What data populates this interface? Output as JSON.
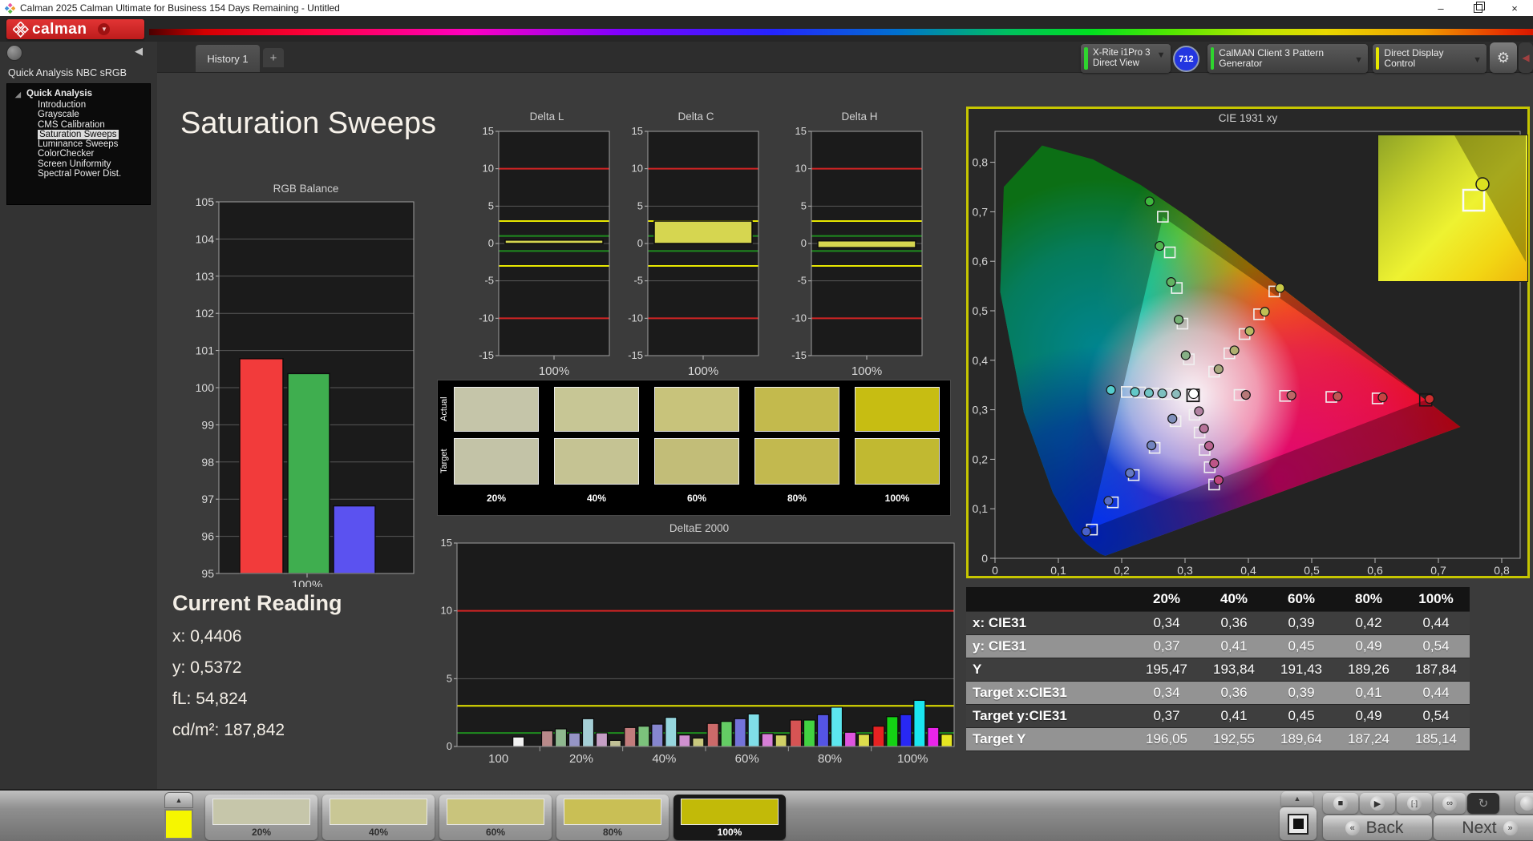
{
  "window": {
    "title": "Calman 2025 Calman Ultimate for Business 154 Days Remaining  - Untitled",
    "minimize": "–",
    "close": "×"
  },
  "logo": {
    "text": "calman"
  },
  "tabs": {
    "active": "History 1",
    "add": "+"
  },
  "toolbar": {
    "meter_line1": "X-Rite i1Pro 3",
    "meter_line2": "Direct View",
    "meter_badge": "712",
    "pattern_generator": "CalMAN Client 3 Pattern Generator",
    "display_control": "Direct Display Control"
  },
  "sidebar": {
    "header": "Quick Analysis NBC sRGB",
    "root": "Quick Analysis",
    "items": [
      {
        "label": "Introduction",
        "selected": false
      },
      {
        "label": "Grayscale",
        "selected": false
      },
      {
        "label": "CMS Calibration",
        "selected": false
      },
      {
        "label": "Saturation Sweeps",
        "selected": true
      },
      {
        "label": "Luminance Sweeps",
        "selected": false
      },
      {
        "label": "ColorChecker",
        "selected": false
      },
      {
        "label": "Screen Uniformity",
        "selected": false
      },
      {
        "label": "Spectral Power Dist.",
        "selected": false
      }
    ]
  },
  "page": {
    "title": "Saturation Sweeps"
  },
  "current_reading": {
    "title": "Current Reading",
    "values": [
      {
        "label": "x:",
        "value": "0,4406"
      },
      {
        "label": "y:",
        "value": "0,5372"
      },
      {
        "label": "fL:",
        "value": "54,824"
      },
      {
        "label": "cd/m²:",
        "value": "187,842"
      }
    ]
  },
  "swatch_panel": {
    "row_labels": [
      "Actual",
      "Target"
    ],
    "col_labels": [
      "20%",
      "40%",
      "60%",
      "80%",
      "100%"
    ],
    "actual_colors": [
      "#c5c5a9",
      "#c7c695",
      "#c8c37b",
      "#c3ba4d",
      "#c7bd12"
    ],
    "target_colors": [
      "#c3c3a7",
      "#c5c393",
      "#c2bd78",
      "#c2b94f",
      "#c1b931"
    ]
  },
  "table": {
    "headers": [
      "",
      "20%",
      "40%",
      "60%",
      "80%",
      "100%"
    ],
    "rows": [
      {
        "label": "x: CIE31",
        "values": [
          "0,34",
          "0,36",
          "0,39",
          "0,42",
          "0,44"
        ]
      },
      {
        "label": "y: CIE31",
        "values": [
          "0,37",
          "0,41",
          "0,45",
          "0,49",
          "0,54"
        ]
      },
      {
        "label": "Y",
        "values": [
          "195,47",
          "193,84",
          "191,43",
          "189,26",
          "187,84"
        ]
      },
      {
        "label": "Target x:CIE31",
        "values": [
          "0,34",
          "0,36",
          "0,39",
          "0,41",
          "0,44"
        ]
      },
      {
        "label": "Target y:CIE31",
        "values": [
          "0,37",
          "0,41",
          "0,45",
          "0,49",
          "0,54"
        ]
      },
      {
        "label": "Target Y",
        "values": [
          "196,05",
          "192,55",
          "189,64",
          "187,24",
          "185,14"
        ]
      }
    ]
  },
  "bottom_bar": {
    "stepper_color": "#f6f600",
    "levels": [
      {
        "label": "20%",
        "color": "#c6c6aa",
        "selected": false
      },
      {
        "label": "40%",
        "color": "#c9c795",
        "selected": false
      },
      {
        "label": "60%",
        "color": "#c9c47c",
        "selected": false
      },
      {
        "label": "80%",
        "color": "#c9bf55",
        "selected": false
      },
      {
        "label": "100%",
        "color": "#c2ba08",
        "selected": true
      }
    ],
    "back": "Back",
    "next": "Next"
  },
  "chart_data": [
    {
      "id": "rgb_balance",
      "type": "bar",
      "title": "RGB Balance",
      "categories": [
        "Red",
        "Green",
        "Blue"
      ],
      "values": [
        100.78,
        100.38,
        96.82
      ],
      "colors": [
        "#f23b3b",
        "#3fae4f",
        "#5b52f0"
      ],
      "xlabel": "100%",
      "ylim": [
        95,
        105
      ],
      "ytick_step": 1
    },
    {
      "id": "delta_l",
      "type": "bar",
      "title": "Delta L",
      "xlabel": "100%",
      "ylim": [
        -15,
        15
      ],
      "yticks": [
        15,
        10,
        5,
        0,
        -5,
        -10,
        -15
      ],
      "bar": {
        "from": 0,
        "to": 0.45
      },
      "bar_color": "#d6d650",
      "limits": {
        "red": 10,
        "yellow": 3,
        "green": 1
      }
    },
    {
      "id": "delta_c",
      "type": "bar",
      "title": "Delta C",
      "xlabel": "100%",
      "ylim": [
        -15,
        15
      ],
      "yticks": [
        15,
        10,
        5,
        0,
        -5,
        -10,
        -15
      ],
      "bar": {
        "from": 0,
        "to": 3.0
      },
      "bar_color": "#d6d650",
      "limits": {
        "red": 10,
        "yellow": 3,
        "green": 1
      }
    },
    {
      "id": "delta_h",
      "type": "bar",
      "title": "Delta H",
      "xlabel": "100%",
      "ylim": [
        -15,
        15
      ],
      "yticks": [
        15,
        10,
        5,
        0,
        -5,
        -10,
        -15
      ],
      "bar": {
        "from": 0.35,
        "to": -0.55
      },
      "bar_color": "#d6d650",
      "limits": {
        "red": 10,
        "yellow": 3,
        "green": 1
      }
    },
    {
      "id": "deltae_2000",
      "type": "grouped-bar",
      "title": "DeltaE 2000",
      "ylim": [
        0,
        15
      ],
      "yticks": [
        0,
        5,
        10,
        15
      ],
      "limits": {
        "red": 10,
        "yellow": 3,
        "green": 1
      },
      "groups": [
        {
          "label": "100",
          "values": [
            0.7
          ],
          "colors": [
            "#f2f2f2"
          ]
        },
        {
          "label": "20%",
          "values": [
            1.15,
            1.3,
            1.0,
            2.05,
            1.0,
            0.45
          ],
          "colors": [
            "#b88989",
            "#8fb88f",
            "#9595c5",
            "#a5cfd6",
            "#c59fc5",
            "#c0c095"
          ]
        },
        {
          "label": "40%",
          "values": [
            1.4,
            1.5,
            1.65,
            2.15,
            0.85,
            0.62
          ],
          "colors": [
            "#c27c7c",
            "#7cc27c",
            "#8686cf",
            "#96d6de",
            "#cf90cf",
            "#c8c87e"
          ]
        },
        {
          "label": "60%",
          "values": [
            1.7,
            1.85,
            2.05,
            2.4,
            0.95,
            0.85
          ],
          "colors": [
            "#cc6a6a",
            "#64cc64",
            "#7373d9",
            "#80dee8",
            "#d67ed6",
            "#d0d066"
          ]
        },
        {
          "label": "80%",
          "values": [
            1.95,
            1.95,
            2.35,
            2.9,
            1.05,
            0.9
          ],
          "colors": [
            "#d65454",
            "#42d242",
            "#5454e4",
            "#5ce6ef",
            "#de54de",
            "#dcdc4c"
          ]
        },
        {
          "label": "100%",
          "values": [
            1.5,
            2.2,
            2.35,
            3.4,
            1.4,
            0.9
          ],
          "colors": [
            "#e62222",
            "#14d214",
            "#2828f4",
            "#1ae6f0",
            "#ea24ea",
            "#e6e622"
          ]
        }
      ]
    },
    {
      "id": "cie_1931",
      "type": "scatter",
      "title": "CIE 1931 xy",
      "xlim": [
        0,
        0.85
      ],
      "ylim": [
        0,
        0.85
      ],
      "xticks": [
        "0",
        "0,1",
        "0,2",
        "0,3",
        "0,4",
        "0,5",
        "0,6",
        "0,7",
        "0,8"
      ],
      "yticks": [
        "0",
        "0,1",
        "0,2",
        "0,3",
        "0,4",
        "0,5",
        "0,6",
        "0,7",
        "0,8"
      ],
      "gamut_triangle": {
        "red": [
          0.68,
          0.32
        ],
        "green": [
          0.265,
          0.69
        ],
        "blue": [
          0.15,
          0.06
        ]
      },
      "white_point": {
        "target": [
          0.3127,
          0.329
        ],
        "measured": [
          0.3135,
          0.3325
        ]
      },
      "sweeps": [
        {
          "name": "red",
          "targets": [
            [
              0.386,
              0.33
            ],
            [
              0.458,
              0.328
            ],
            [
              0.531,
              0.326
            ],
            [
              0.604,
              0.323
            ],
            [
              0.68,
              0.32
            ]
          ],
          "measured": [
            [
              0.396,
              0.33
            ],
            [
              0.468,
              0.329
            ],
            [
              0.541,
              0.327
            ],
            [
              0.612,
              0.325
            ],
            [
              0.686,
              0.322
            ]
          ],
          "fills": [
            "#b87878",
            "#bd6666",
            "#c25454",
            "#c74242",
            "#cc2e2e"
          ]
        },
        {
          "name": "green",
          "targets": [
            [
              0.306,
              0.402
            ],
            [
              0.296,
              0.474
            ],
            [
              0.287,
              0.546
            ],
            [
              0.276,
              0.618
            ],
            [
              0.265,
              0.69
            ]
          ],
          "measured": [
            [
              0.301,
              0.41
            ],
            [
              0.29,
              0.482
            ],
            [
              0.278,
              0.558
            ],
            [
              0.26,
              0.631
            ],
            [
              0.244,
              0.721
            ]
          ],
          "fills": [
            "#86b086",
            "#74b274",
            "#62b462",
            "#50b650",
            "#3eb83e"
          ]
        },
        {
          "name": "yellow",
          "targets": [
            [
              0.346,
              0.377
            ],
            [
              0.37,
              0.414
            ],
            [
              0.394,
              0.453
            ],
            [
              0.417,
              0.493
            ],
            [
              0.441,
              0.539
            ]
          ],
          "measured": [
            [
              0.353,
              0.382
            ],
            [
              0.378,
              0.42
            ],
            [
              0.402,
              0.459
            ],
            [
              0.426,
              0.498
            ],
            [
              0.45,
              0.546
            ]
          ],
          "fills": [
            "#a8a87e",
            "#b0b070",
            "#b8b862",
            "#c0c054",
            "#c8c846"
          ]
        },
        {
          "name": "cyan",
          "targets": [
            [
              0.292,
              0.331
            ],
            [
              0.271,
              0.332
            ],
            [
              0.25,
              0.333
            ],
            [
              0.229,
              0.335
            ],
            [
              0.208,
              0.336
            ]
          ],
          "measured": [
            [
              0.286,
              0.332
            ],
            [
              0.264,
              0.333
            ],
            [
              0.243,
              0.334
            ],
            [
              0.221,
              0.336
            ],
            [
              0.183,
              0.34
            ]
          ],
          "fills": [
            "#8cbcbc",
            "#7ec0c0",
            "#70c4c4",
            "#62c8c8",
            "#54cccc"
          ]
        },
        {
          "name": "magenta",
          "targets": [
            [
              0.315,
              0.29
            ],
            [
              0.323,
              0.254
            ],
            [
              0.331,
              0.219
            ],
            [
              0.339,
              0.184
            ],
            [
              0.346,
              0.149
            ]
          ],
          "measured": [
            [
              0.322,
              0.297
            ],
            [
              0.33,
              0.262
            ],
            [
              0.338,
              0.227
            ],
            [
              0.346,
              0.192
            ],
            [
              0.353,
              0.158
            ]
          ],
          "fills": [
            "#b282a2",
            "#b67399",
            "#ba6490",
            "#be5587",
            "#c2467e"
          ]
        },
        {
          "name": "blue",
          "targets": [
            [
              0.285,
              0.277
            ],
            [
              0.252,
              0.223
            ],
            [
              0.219,
              0.168
            ],
            [
              0.186,
              0.113
            ],
            [
              0.153,
              0.058
            ]
          ],
          "measured": [
            [
              0.28,
              0.282
            ],
            [
              0.247,
              0.228
            ],
            [
              0.213,
              0.172
            ],
            [
              0.179,
              0.116
            ],
            [
              0.144,
              0.054
            ]
          ],
          "fills": [
            "#8090bc",
            "#7284c0",
            "#6478c4",
            "#566cc8",
            "#4860cc"
          ]
        }
      ]
    }
  ]
}
